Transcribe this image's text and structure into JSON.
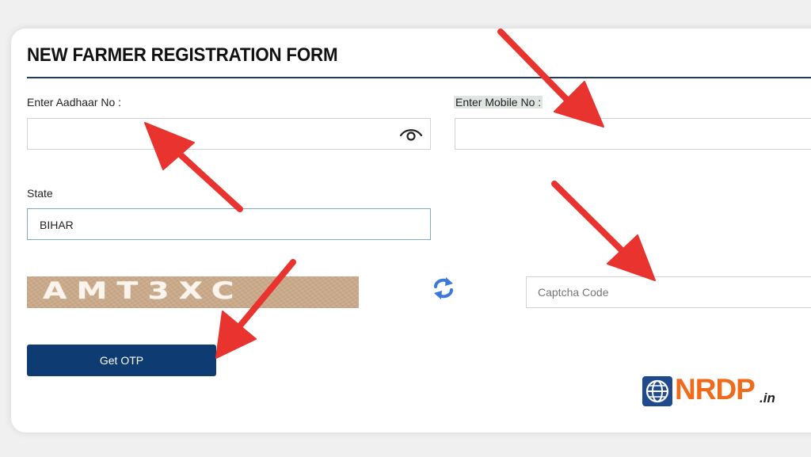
{
  "form": {
    "title": "NEW FARMER REGISTRATION FORM",
    "aadhaar": {
      "label": "Enter Aadhaar No :",
      "value": ""
    },
    "mobile": {
      "label": "Enter Mobile No :",
      "value": ""
    },
    "state": {
      "label": "State",
      "value": "BIHAR"
    },
    "captcha": {
      "image_text": "AMT3XC",
      "placeholder": "Captcha Code",
      "value": ""
    },
    "submit_label": "Get OTP"
  },
  "watermark": {
    "brand": "NRDP",
    "suffix": ".in"
  },
  "colors": {
    "title_rule": "#1d3d67",
    "button": "#0d3b72",
    "arrow": "#e8332e",
    "refresh_icon": "#3b78d8",
    "logo_orange": "#f06a1c"
  },
  "icons": [
    "eye-icon",
    "refresh-icon",
    "globe-icon"
  ]
}
